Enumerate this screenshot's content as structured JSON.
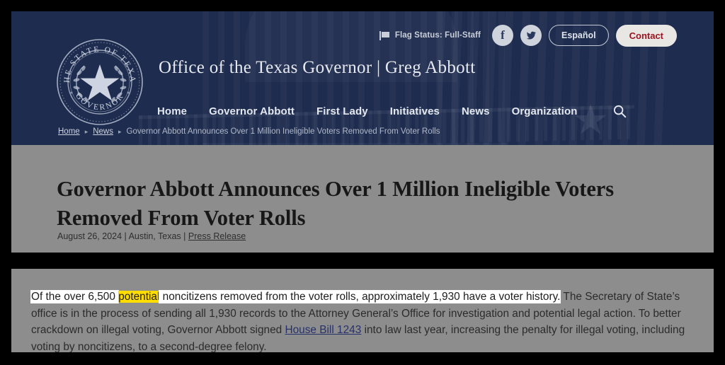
{
  "colors": {
    "header_navy": "#1e2c4f",
    "section_gray": "#8d8d8d",
    "contact_red": "#9b1420",
    "highlight_yellow": "#ffdd00",
    "selection_white": "#ffffff",
    "link_blue": "#26316b",
    "frame_black": "#000000"
  },
  "header": {
    "flag_status": "Flag Status: Full-Staff",
    "flag_icon": "flag-icon",
    "social": [
      {
        "name": "facebook-icon",
        "glyph": "f"
      },
      {
        "name": "twitter-icon",
        "glyph": "🐦"
      }
    ],
    "espanol_label": "Español",
    "contact_label": "Contact",
    "seal": {
      "name": "texas-governor-seal",
      "top_text": "THE STATE OF TEXAS",
      "bottom_text": "GOVERNOR"
    },
    "site_title": "Office of the Texas Governor | Greg Abbott",
    "nav": [
      {
        "label": "Home",
        "name": "nav-item-home"
      },
      {
        "label": "Governor Abbott",
        "name": "nav-item-governor-abbott"
      },
      {
        "label": "First Lady",
        "name": "nav-item-first-lady"
      },
      {
        "label": "Initiatives",
        "name": "nav-item-initiatives"
      },
      {
        "label": "News",
        "name": "nav-item-news"
      },
      {
        "label": "Organization",
        "name": "nav-item-organization"
      }
    ],
    "search_icon": "search-icon",
    "breadcrumb": {
      "home": "Home",
      "news": "News",
      "current": "Governor Abbott Announces Over 1 Million Ineligible Voters Removed From Voter Rolls",
      "separator": "▸"
    }
  },
  "article": {
    "title": "Governor Abbott Announces Over 1 Million Ineligible Voters Removed From Voter Rolls",
    "meta": {
      "date": "August 26, 2024",
      "sep1": " | ",
      "location": "Austin, Texas",
      "sep2": " | ",
      "type": "Press Release"
    }
  },
  "body": {
    "selected_part1": "Of the over 6,500 ",
    "highlighted_word": "potential",
    "selected_part2": " noncitizens removed from the voter rolls, approximately 1,930 have a voter history.",
    "rest_part1": " The Secretary of State’s office is in the process of sending all 1,930 records to the Attorney General’s Office for investigation and potential legal action. To better crackdown on illegal voting, Governor Abbott signed ",
    "link_text": "House Bill 1243",
    "rest_part2": " into law last year, increasing the penalty for illegal voting, including voting by noncitizens, to a second-degree felony."
  }
}
